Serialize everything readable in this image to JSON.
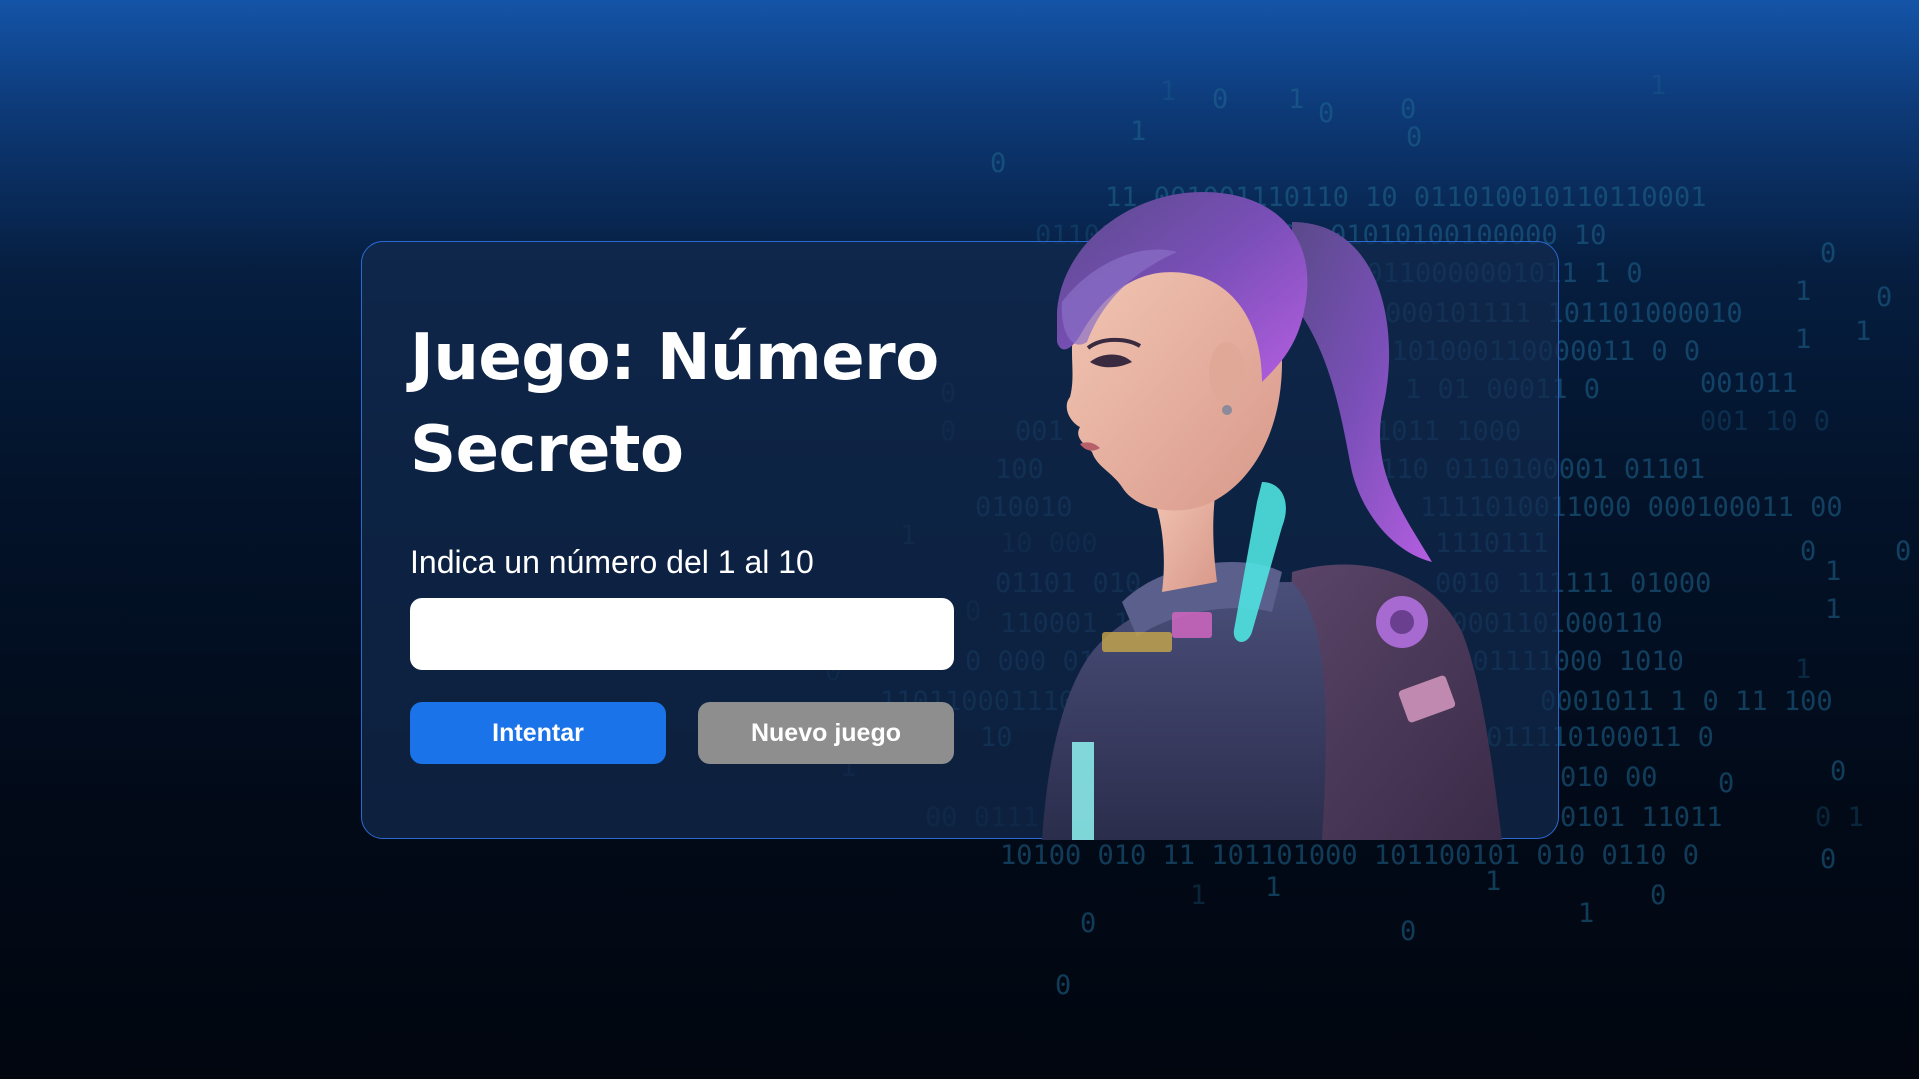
{
  "game": {
    "title": "Juego: Número Secreto",
    "instruction": "Indica un número del 1 al 10",
    "input_value": "",
    "try_button_label": "Intentar",
    "new_game_button_label": "Nuevo juego"
  },
  "colors": {
    "background_top": "#1454a8",
    "background_bottom": "#01060f",
    "card_border": "#2c6ad1",
    "try_button": "#1a73e8",
    "new_game_button": "#8e8e8e",
    "binary_digits": "#1f6790",
    "hair_purple": "#9a4fd0",
    "suit_glow": "#4fe3e0"
  },
  "decorations": {
    "background": "binary-code-rain",
    "illustration": "astronaut-girl-illustration"
  }
}
